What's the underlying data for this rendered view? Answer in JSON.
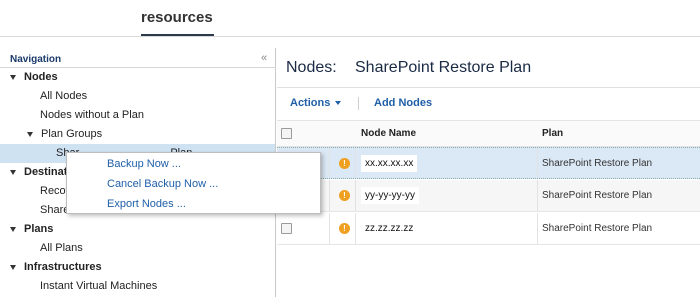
{
  "header": {
    "tab_label": "resources"
  },
  "navigation": {
    "title": "Navigation",
    "tree": {
      "nodes": "Nodes",
      "all_nodes": "All Nodes",
      "nodes_without_plan": "Nodes without a Plan",
      "plan_groups": "Plan Groups",
      "selected_group": "SharePoint Restore Plan",
      "selected_group_visible": "Shar",
      "selected_group_tail": "Plan",
      "destinations": "Destination",
      "recovery_visible": "Recover",
      "shared_visible": "Shared",
      "plans": "Plans",
      "all_plans": "All Plans",
      "infrastructures": "Infrastructures",
      "instant_vms": "Instant Virtual Machines"
    }
  },
  "context_menu": {
    "items": [
      "Backup Now ...",
      "Cancel Backup Now ...",
      "Export Nodes ..."
    ]
  },
  "main": {
    "title_label": "Nodes:",
    "title_name": "SharePoint Restore Plan",
    "toolbar": {
      "actions": "Actions",
      "add_nodes": "Add Nodes"
    },
    "columns": {
      "node_name": "Node Name",
      "plan": "Plan"
    },
    "rows": [
      {
        "node_name": "xx.xx.xx.xx",
        "plan": "SharePoint Restore Plan",
        "status": "warning"
      },
      {
        "node_name": "yy-yy-yy-yy",
        "plan": "SharePoint Restore Plan",
        "status": "warning"
      },
      {
        "node_name": "zz.zz.zz.zz",
        "plan": "SharePoint Restore Plan",
        "status": "warning"
      }
    ]
  },
  "colors": {
    "accent": "#1f5fa8",
    "selection": "#cfe2f2",
    "warning": "#f0a020"
  }
}
